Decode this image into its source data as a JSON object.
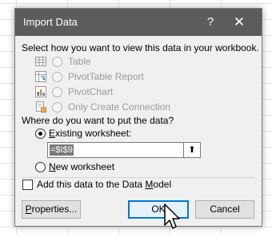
{
  "dialog": {
    "title": "Import Data",
    "help_label": "?",
    "close_label": "✕"
  },
  "view": {
    "prompt": "Select how you want to view this data in your workbook.",
    "options": [
      {
        "label": "Table",
        "icon": "table-icon",
        "enabled": false
      },
      {
        "label": "PivotTable Report",
        "icon": "pivottable-icon",
        "enabled": false
      },
      {
        "label": "PivotChart",
        "icon": "pivotchart-icon",
        "enabled": false
      },
      {
        "label": "Only Create Connection",
        "icon": "connection-icon",
        "enabled": false
      }
    ]
  },
  "placement": {
    "prompt": "Where do you want to put the data?",
    "existing_label": "Existing worksheet:",
    "existing_selected": true,
    "reference_value": "=$I$9",
    "new_label": "New worksheet",
    "new_selected": false
  },
  "data_model": {
    "label": "Add this data to the Data Model",
    "checked": false
  },
  "buttons": {
    "properties": "Properties...",
    "ok": "OK",
    "cancel": "Cancel"
  },
  "colors": {
    "titlebar": "#5c5c5c",
    "accent": "#0078d7",
    "dialog_bg": "#f0f0f0"
  }
}
